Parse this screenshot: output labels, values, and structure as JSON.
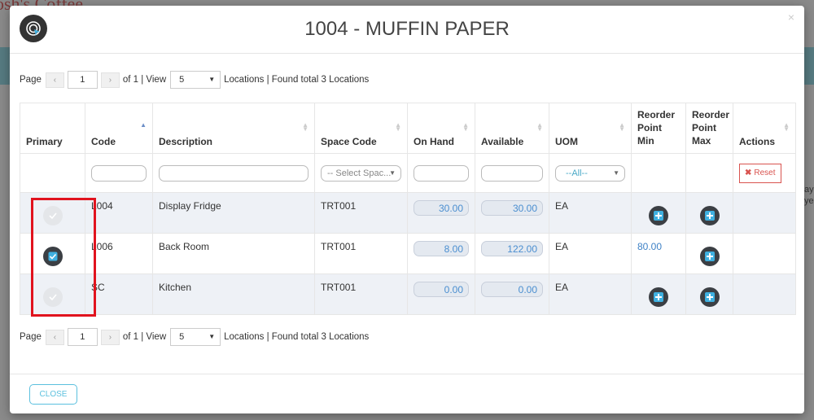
{
  "background": {
    "app_title": "osh's Coffee",
    "side_text": "ay ye"
  },
  "modal": {
    "title": "1004 - MUFFIN PAPER",
    "close_icon": "×"
  },
  "pager": {
    "page_label": "Page",
    "prev": "‹",
    "page_value": "1",
    "next": "›",
    "of_text": "of 1 | View",
    "view_value": "5",
    "found_text": "Locations | Found total 3 Locations"
  },
  "columns": {
    "primary": "Primary",
    "code": "Code",
    "description": "Description",
    "space_code": "Space Code",
    "on_hand": "On Hand",
    "available": "Available",
    "uom": "UOM",
    "reorder_min": "Reorder Point Min",
    "reorder_max": "Reorder Point Max",
    "actions": "Actions"
  },
  "filters": {
    "space_code_placeholder": "-- Select Spac...",
    "uom_value": "--All--",
    "reset_label": "Reset"
  },
  "rows": [
    {
      "primary": false,
      "code": "L004",
      "description": "Display Fridge",
      "space_code": "TRT001",
      "on_hand": "30.00",
      "available": "30.00",
      "uom": "EA",
      "reorder_min": "",
      "reorder_max": ""
    },
    {
      "primary": true,
      "code": "L006",
      "description": "Back Room",
      "space_code": "TRT001",
      "on_hand": "8.00",
      "available": "122.00",
      "uom": "EA",
      "reorder_min": "80.00",
      "reorder_max": ""
    },
    {
      "primary": false,
      "code": "SC",
      "description": "Kitchen",
      "space_code": "TRT001",
      "on_hand": "0.00",
      "available": "0.00",
      "uom": "EA",
      "reorder_min": "",
      "reorder_max": ""
    }
  ],
  "footer": {
    "close_label": "CLOSE"
  },
  "colors": {
    "accent": "#5bc0de",
    "highlight": "#e1131e",
    "danger": "#d9534f",
    "value_blue": "#4a8ed0"
  }
}
